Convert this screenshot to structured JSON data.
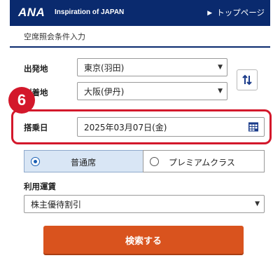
{
  "header": {
    "logo": "ANA",
    "tagline": "Inspiration of JAPAN",
    "top_link": "トップページ"
  },
  "page": {
    "subtitle": "空席照会条件入力"
  },
  "form": {
    "departure": {
      "label": "出発地",
      "value": "東京(羽田)"
    },
    "arrival": {
      "label": "到着地",
      "value": "大阪(伊丹)"
    },
    "date": {
      "label": "搭乗日",
      "value": "2025年03月07日(金)"
    },
    "step_badge": "6",
    "cabin": {
      "options": [
        "普通席",
        "プレミアムクラス"
      ],
      "selected": "普通席"
    },
    "fare": {
      "label": "利用運賃",
      "value": "株主優待割引"
    },
    "search_label": "検索する"
  },
  "colors": {
    "header_bg": "#0a2a6e",
    "highlight": "#d3182b",
    "search_button": "#d9531e",
    "selected_cabin_bg": "#d9e6f5"
  }
}
